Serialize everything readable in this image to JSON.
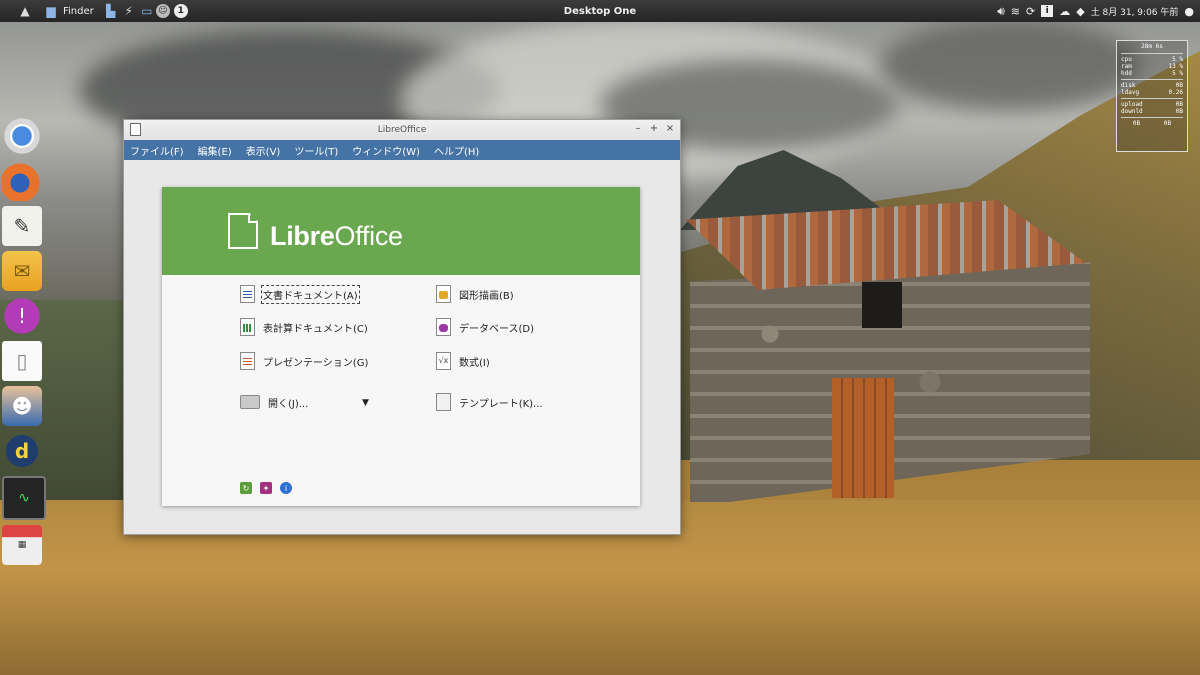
{
  "top_panel": {
    "finder_label": "Finder",
    "desktop_title": "Desktop One",
    "clock": "土  8月 31,  9:06 午前",
    "workspace_number": "1"
  },
  "conky": {
    "uptime": "28m 6s",
    "rows": [
      {
        "label": "cpu",
        "value": "5 %"
      },
      {
        "label": "ram",
        "value": "13 %"
      },
      {
        "label": "hdd",
        "value": "5 %"
      }
    ],
    "rows2": [
      {
        "label": "disk",
        "value": "0B"
      },
      {
        "label": "ldavg",
        "value": "0.26"
      }
    ],
    "rows3": [
      {
        "label": "upload",
        "value": "0B"
      },
      {
        "label": "downld",
        "value": "0B"
      }
    ],
    "totals": {
      "left": "0B",
      "right": "0B"
    }
  },
  "lo_window": {
    "title": "LibreOffice",
    "menu": [
      "ファイル(F)",
      "編集(E)",
      "表示(V)",
      "ツール(T)",
      "ウィンドウ(W)",
      "ヘルプ(H)"
    ],
    "logo": {
      "bold": "Libre",
      "regular": "Office"
    },
    "apps": {
      "writer": "文書ドキュメント(A)",
      "draw": "図形描画(B)",
      "calc": "表計算ドキュメント(C)",
      "base": "データベース(D)",
      "impress": "プレゼンテーション(G)",
      "math": "数式(I)",
      "open": "開く(J)...",
      "templates": "テンプレート(K)..."
    },
    "math_icon_text": "√x"
  }
}
